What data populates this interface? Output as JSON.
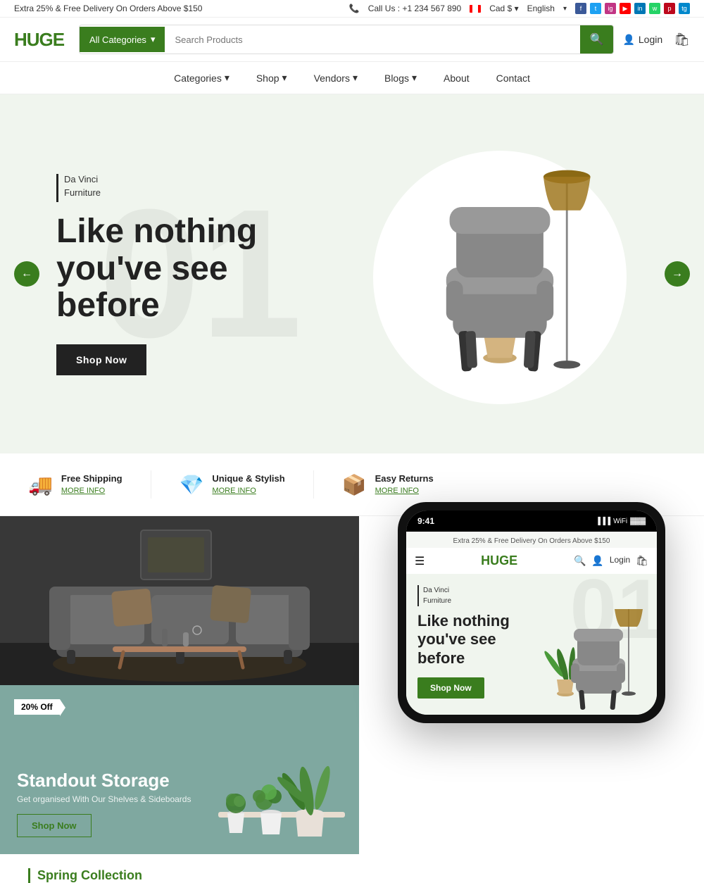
{
  "topbar": {
    "promo_text": "Extra 25% & Free Delivery On Orders Above $150",
    "phone_label": "Call Us : +1 234 567 890",
    "currency": "Cad $",
    "language": "English",
    "social_links": [
      "f",
      "t",
      "ig",
      "yt",
      "in",
      "wp",
      "pin",
      "tg"
    ]
  },
  "header": {
    "logo": "HUGE",
    "search_category": "All Categories",
    "search_placeholder": "Search Products",
    "login_label": "Login"
  },
  "nav": {
    "items": [
      {
        "label": "Categories",
        "has_dropdown": true
      },
      {
        "label": "Shop",
        "has_dropdown": true
      },
      {
        "label": "Vendors",
        "has_dropdown": true
      },
      {
        "label": "Blogs",
        "has_dropdown": true
      },
      {
        "label": "About",
        "has_dropdown": false
      },
      {
        "label": "Contact",
        "has_dropdown": false
      }
    ]
  },
  "hero": {
    "number": "01",
    "brand_line1": "Da Vinci",
    "brand_line2": "Furniture",
    "headline": "Like nothing you've see before",
    "shop_btn": "Shop Now",
    "prev_arrow": "←",
    "next_arrow": "→"
  },
  "features": [
    {
      "icon": "🚚",
      "title": "Free Shipping",
      "link": "MORE INFO"
    },
    {
      "icon": "💎",
      "title": "Unique & Stylish",
      "link": "MORE INFO"
    },
    {
      "icon": "📦",
      "title": "Easy Returns",
      "link": "MORE INFO"
    }
  ],
  "promo_card": {
    "badge": "20% Off",
    "title": "Standout Storage",
    "subtitle": "Get organised With Our Shelves & Sideboards",
    "shop_btn": "Shop Now"
  },
  "phone_mockup": {
    "time": "9:41",
    "topbar_text": "Extra 25% & Free Delivery On Orders Above $150",
    "logo": "HUGE",
    "login_label": "Login",
    "hero_number": "01",
    "brand_line1": "Da Vinci",
    "brand_line2": "Furniture",
    "headline": "Like nothing you've see before",
    "shop_btn": "Shop Now"
  },
  "spring": {
    "title": "Spring Collection"
  },
  "colors": {
    "green": "#3a7d1e",
    "dark": "#222222",
    "light_bg": "#f0f5ee",
    "teal": "#7fa8a0"
  }
}
